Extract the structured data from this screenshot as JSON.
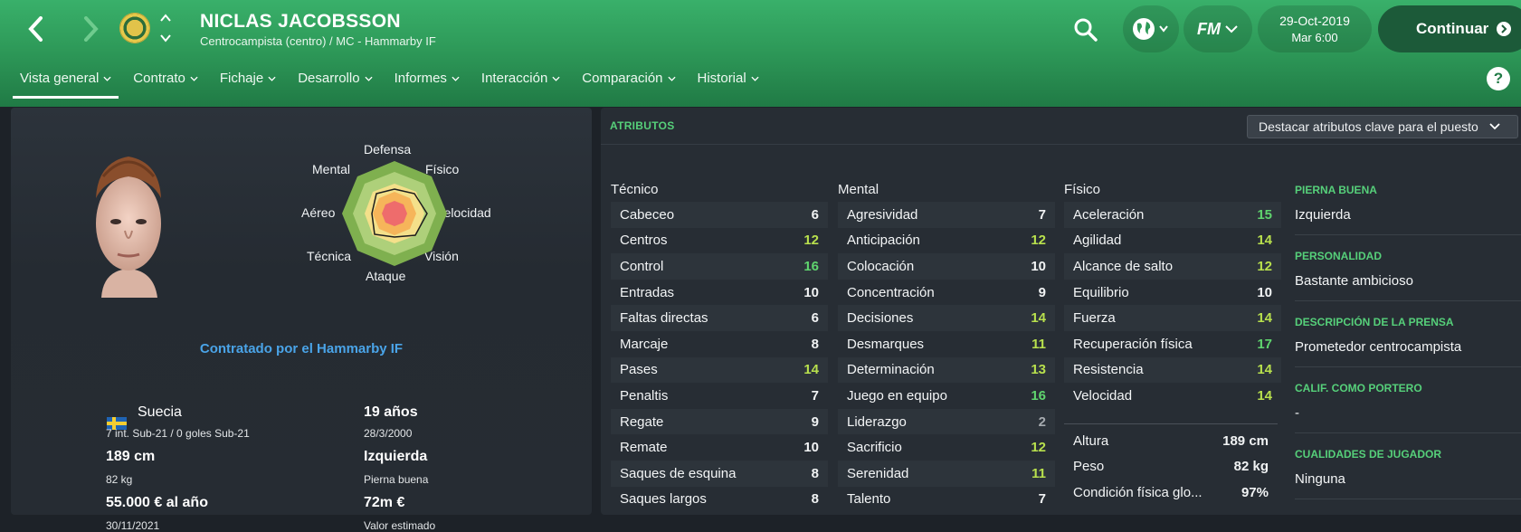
{
  "header": {
    "player_name": "NICLAS JACOBSSON",
    "player_subtitle": "Centrocampista (centro) / MC - Hammarby IF",
    "date": "29-Oct-2019",
    "time": "Mar 6:00",
    "fm_label": "FM",
    "continue_label": "Continuar",
    "help_label": "?",
    "accent_color": "#2e9a59"
  },
  "tabs": [
    {
      "label": "Vista general"
    },
    {
      "label": "Contrato"
    },
    {
      "label": "Fichaje"
    },
    {
      "label": "Desarrollo"
    },
    {
      "label": "Informes"
    },
    {
      "label": "Interacción"
    },
    {
      "label": "Comparación"
    },
    {
      "label": "Historial"
    }
  ],
  "overview": {
    "radar_labels": {
      "top": "Defensa",
      "top_left": "Mental",
      "top_right": "Físico",
      "left": "Aéreo",
      "right": "Velocidad",
      "bottom_left": "Técnica",
      "bottom_right": "Visión",
      "bottom": "Ataque"
    },
    "nationality": "Suecia",
    "caps": "7 int. Sub-21 / 0 goles Sub-21",
    "age": "19 años",
    "birthdate": "28/3/2000",
    "height": "189 cm",
    "weight": "82 kg",
    "foot": "Izquierda",
    "foot_label": "Pierna buena",
    "wage": "55.000 € al año",
    "contract_end": "30/11/2021",
    "value": "72m €",
    "value_label": "Valor estimado",
    "signed_by": "Contratado por el Hammarby IF"
  },
  "attributes": {
    "title": "ATRIBUTOS",
    "highlight_option": "Destacar atributos clave para el puesto",
    "technical_title": "Técnico",
    "mental_title": "Mental",
    "physical_title": "Físico",
    "technical": [
      {
        "name": "Cabeceo",
        "value": "6",
        "tier": "v-mid"
      },
      {
        "name": "Centros",
        "value": "12",
        "tier": "v-good"
      },
      {
        "name": "Control",
        "value": "16",
        "tier": "v-vgood"
      },
      {
        "name": "Entradas",
        "value": "10",
        "tier": "v-mid"
      },
      {
        "name": "Faltas directas",
        "value": "6",
        "tier": "v-mid"
      },
      {
        "name": "Marcaje",
        "value": "8",
        "tier": "v-mid"
      },
      {
        "name": "Pases",
        "value": "14",
        "tier": "v-good"
      },
      {
        "name": "Penaltis",
        "value": "7",
        "tier": "v-mid"
      },
      {
        "name": "Regate",
        "value": "9",
        "tier": "v-mid"
      },
      {
        "name": "Remate",
        "value": "10",
        "tier": "v-mid"
      },
      {
        "name": "Saques de esquina",
        "value": "8",
        "tier": "v-mid"
      },
      {
        "name": "Saques largos",
        "value": "8",
        "tier": "v-mid"
      }
    ],
    "mental": [
      {
        "name": "Agresividad",
        "value": "7",
        "tier": "v-mid"
      },
      {
        "name": "Anticipación",
        "value": "12",
        "tier": "v-good"
      },
      {
        "name": "Colocación",
        "value": "10",
        "tier": "v-mid"
      },
      {
        "name": "Concentración",
        "value": "9",
        "tier": "v-mid"
      },
      {
        "name": "Decisiones",
        "value": "14",
        "tier": "v-good"
      },
      {
        "name": "Desmarques",
        "value": "11",
        "tier": "v-good"
      },
      {
        "name": "Determinación",
        "value": "13",
        "tier": "v-good"
      },
      {
        "name": "Juego en equipo",
        "value": "16",
        "tier": "v-vgood"
      },
      {
        "name": "Liderazgo",
        "value": "2",
        "tier": "v-low"
      },
      {
        "name": "Sacrificio",
        "value": "12",
        "tier": "v-good"
      },
      {
        "name": "Serenidad",
        "value": "11",
        "tier": "v-good"
      },
      {
        "name": "Talento",
        "value": "7",
        "tier": "v-mid"
      }
    ],
    "physical": [
      {
        "name": "Aceleración",
        "value": "15",
        "tier": "v-vgood"
      },
      {
        "name": "Agilidad",
        "value": "14",
        "tier": "v-good"
      },
      {
        "name": "Alcance de salto",
        "value": "12",
        "tier": "v-good"
      },
      {
        "name": "Equilibrio",
        "value": "10",
        "tier": "v-mid"
      },
      {
        "name": "Fuerza",
        "value": "14",
        "tier": "v-good"
      },
      {
        "name": "Recuperación física",
        "value": "17",
        "tier": "v-vgood"
      },
      {
        "name": "Resistencia",
        "value": "14",
        "tier": "v-good"
      },
      {
        "name": "Velocidad",
        "value": "14",
        "tier": "v-good"
      }
    ],
    "physical_extra": [
      {
        "name": "Altura",
        "value": "189 cm"
      },
      {
        "name": "Peso",
        "value": "82 kg"
      },
      {
        "name": "Condición física glo...",
        "value": "97%"
      }
    ],
    "side": [
      {
        "label": "PIERNA BUENA",
        "value": "Izquierda"
      },
      {
        "label": "PERSONALIDAD",
        "value": "Bastante ambicioso"
      },
      {
        "label": "DESCRIPCIÓN DE LA PRENSA",
        "value": "Prometedor centrocampista"
      },
      {
        "label": "CALIF. COMO PORTERO",
        "value": "-"
      },
      {
        "label": "CUALIDADES DE JUGADOR",
        "value": "Ninguna"
      }
    ]
  }
}
